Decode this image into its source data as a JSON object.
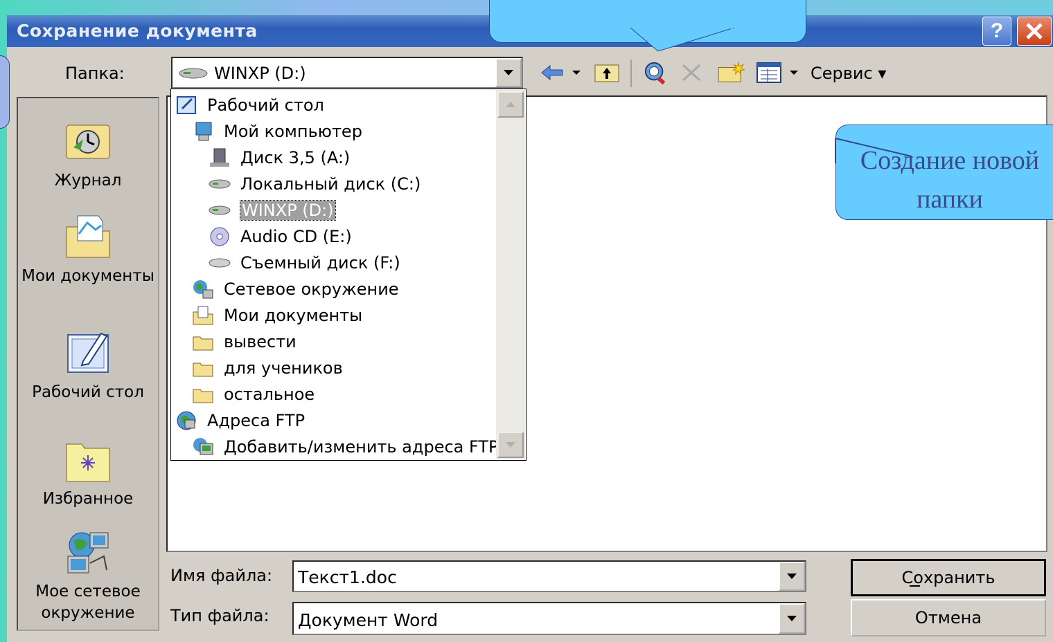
{
  "window": {
    "title": "Сохранение документа",
    "help_label": "?",
    "close_label": "✕"
  },
  "toolbar": {
    "folder_label": "Папка:",
    "folder_value": "WINXP (D:)",
    "service_label": "Сервис ▾"
  },
  "places": [
    {
      "label": "Журнал",
      "icon": "history-icon"
    },
    {
      "label": "Мои документы",
      "icon": "my-documents-icon"
    },
    {
      "label": "Рабочий стол",
      "icon": "desktop-icon"
    },
    {
      "label": "Избранное",
      "icon": "favorites-icon"
    },
    {
      "label": "Мое сетевое окружение",
      "icon": "network-icon"
    }
  ],
  "dropdown_items": [
    {
      "label": "Рабочий стол",
      "level": 0,
      "icon": "desktop-icon"
    },
    {
      "label": "Мой компьютер",
      "level": 1,
      "icon": "computer-icon"
    },
    {
      "label": "Диск 3,5 (A:)",
      "level": 2,
      "icon": "floppy-icon"
    },
    {
      "label": "Локальный диск (C:)",
      "level": 2,
      "icon": "drive-icon"
    },
    {
      "label": "WINXP (D:)",
      "level": 2,
      "icon": "drive-icon",
      "selected": true
    },
    {
      "label": "Audio CD (E:)",
      "level": 2,
      "icon": "cd-icon"
    },
    {
      "label": "Съемный диск (F:)",
      "level": 2,
      "icon": "removable-drive-icon"
    },
    {
      "label": "Сетевое окружение",
      "level": 1,
      "icon": "network-icon"
    },
    {
      "label": "Мои документы",
      "level": 1,
      "icon": "my-documents-icon"
    },
    {
      "label": "вывести",
      "level": 1,
      "icon": "folder-icon"
    },
    {
      "label": "для учеников",
      "level": 1,
      "icon": "folder-icon"
    },
    {
      "label": "остальное",
      "level": 1,
      "icon": "folder-icon"
    },
    {
      "label": "Адреса FTP",
      "level": 0,
      "icon": "ftp-icon"
    },
    {
      "label": "Добавить/изменить адреса FTP",
      "level": 1,
      "icon": "ftp-edit-icon"
    }
  ],
  "form": {
    "filename_label": "Имя файла:",
    "filename_value": "Текст1.doc",
    "filetype_label": "Тип файла:",
    "filetype_value": "Документ Word",
    "save_label": "Сохранить",
    "cancel_label": "Отмена"
  },
  "callouts": {
    "new_folder": "Создание новой папки"
  },
  "colors": {
    "callout": "#66ccff",
    "titlebar": "#3466c0",
    "dialog": "#d4d0c8"
  }
}
